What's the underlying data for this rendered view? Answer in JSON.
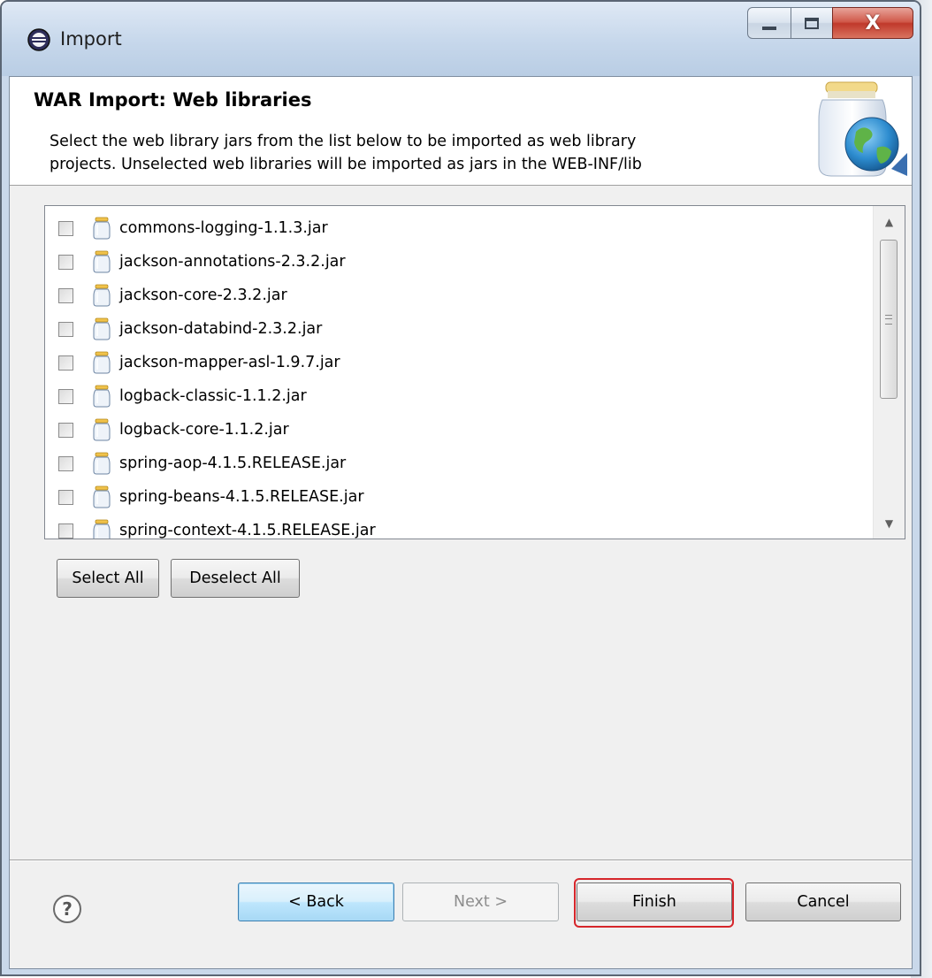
{
  "window": {
    "title": "Import",
    "controls": {
      "minimize": "minimize",
      "maximize": "maximize",
      "close": "X"
    }
  },
  "header": {
    "title": "WAR Import: Web libraries",
    "description_line1": "Select the web library jars from the list below to be imported as web library",
    "description_line2": "projects.  Unselected web libraries will be imported as jars in the WEB-INF/lib",
    "image_icon": "jar-globe-icon"
  },
  "libraries": {
    "items": [
      {
        "label": "commons-logging-1.1.3.jar",
        "checked": false
      },
      {
        "label": "jackson-annotations-2.3.2.jar",
        "checked": false
      },
      {
        "label": "jackson-core-2.3.2.jar",
        "checked": false
      },
      {
        "label": "jackson-databind-2.3.2.jar",
        "checked": false
      },
      {
        "label": "jackson-mapper-asl-1.9.7.jar",
        "checked": false
      },
      {
        "label": "logback-classic-1.1.2.jar",
        "checked": false
      },
      {
        "label": "logback-core-1.1.2.jar",
        "checked": false
      },
      {
        "label": "spring-aop-4.1.5.RELEASE.jar",
        "checked": false
      },
      {
        "label": "spring-beans-4.1.5.RELEASE.jar",
        "checked": false
      },
      {
        "label": "spring-context-4.1.5.RELEASE.jar",
        "checked": false
      }
    ]
  },
  "selection_buttons": {
    "select_all": "Select All",
    "deselect_all": "Deselect All"
  },
  "footer": {
    "help": "?",
    "back": "< Back",
    "next": "Next >",
    "finish": "Finish",
    "cancel": "Cancel"
  },
  "colors": {
    "highlight": "#d6262b",
    "title_bar": "#c6d7eb",
    "close_button": "#c0392b"
  }
}
